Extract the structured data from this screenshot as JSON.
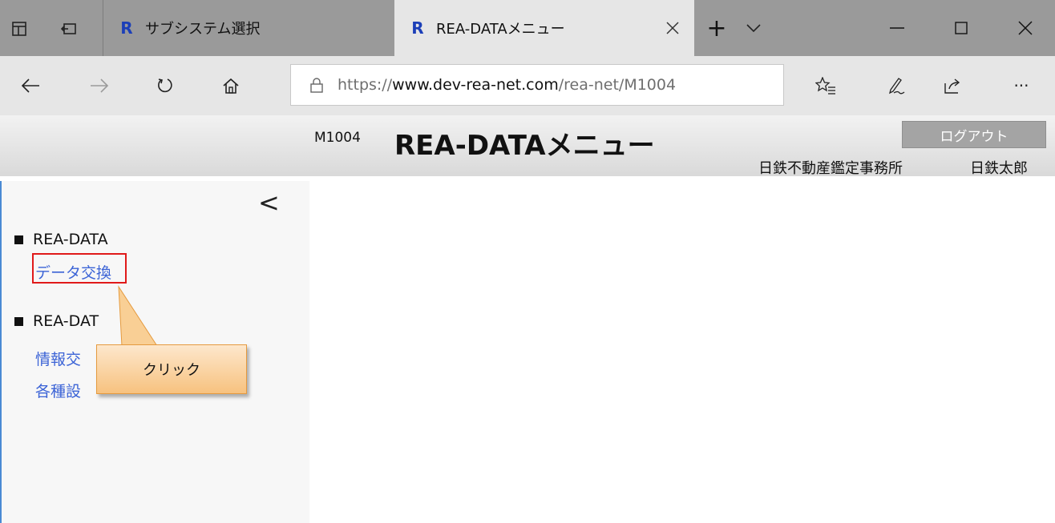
{
  "browser": {
    "inactive_tab_title": "サブシステム選択",
    "active_tab_title": "REA-DATAメニュー",
    "favicon_letter": "R",
    "new_tab_symbol": "+",
    "url_scheme": "https://",
    "url_host": "www.dev-rea-net.com",
    "url_path": "/rea-net/M1004",
    "more_symbol": "···"
  },
  "header": {
    "page_code": "M1004",
    "page_title": "REA-DATAメニュー",
    "logout_label": "ログアウト",
    "office_name": "日鉄不動産鑑定事務所",
    "user_name": "日鉄太郎"
  },
  "sidebar": {
    "collapse_symbol": "<",
    "sections": [
      {
        "title": "REA-DATA",
        "items": [
          "データ交換"
        ]
      },
      {
        "title": "REA-DAT",
        "items": [
          "情報交",
          "各種設"
        ]
      }
    ]
  },
  "callout": {
    "text": "クリック"
  },
  "colors": {
    "accent_link": "#3b63d6",
    "highlight_border": "#e01a1a",
    "callout_fill": "#f7c27f"
  }
}
